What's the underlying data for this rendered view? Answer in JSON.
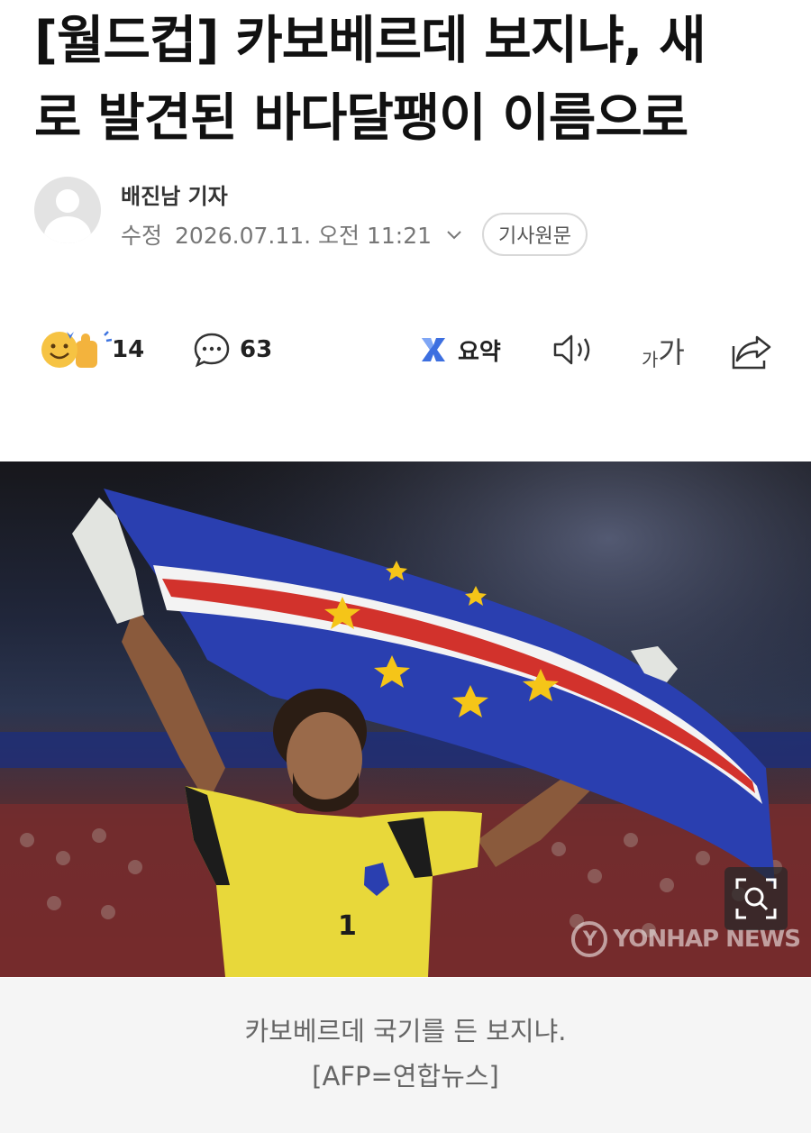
{
  "article": {
    "headline_line1": "[월드컵] 카보베르데 보지냐, 새",
    "headline_line2": "로 발견된 바다달팽이 이름으로"
  },
  "byline": {
    "reporter": "배진남 기자",
    "edit_label": "수정",
    "timestamp": "2026.07.11. 오전 11:21",
    "original_button": "기사원문"
  },
  "toolbar": {
    "reaction_count": "14",
    "comment_count": "63",
    "summary_label": "요약",
    "font_small": "가",
    "font_big": "가"
  },
  "photo": {
    "watermark": "YONHAP NEWS",
    "jersey_number": "1"
  },
  "caption": {
    "line1": "카보베르데 국기를 든 보지냐.",
    "line2": "[AFP=연합뉴스]"
  },
  "colors": {
    "flag_blue": "#2a3fb0",
    "flag_red": "#d2322c",
    "flag_star": "#f5c518",
    "jersey_yellow": "#e8d83a",
    "summary_icon_blue": "#3d6fe0"
  },
  "icons": {
    "reaction": "emoji-reaction-icon",
    "comment": "comment-bubble-icon",
    "summary": "summary-icon",
    "tts": "speaker-icon",
    "share": "share-icon",
    "zoom": "zoom-icon",
    "chevron": "chevron-down-icon"
  }
}
